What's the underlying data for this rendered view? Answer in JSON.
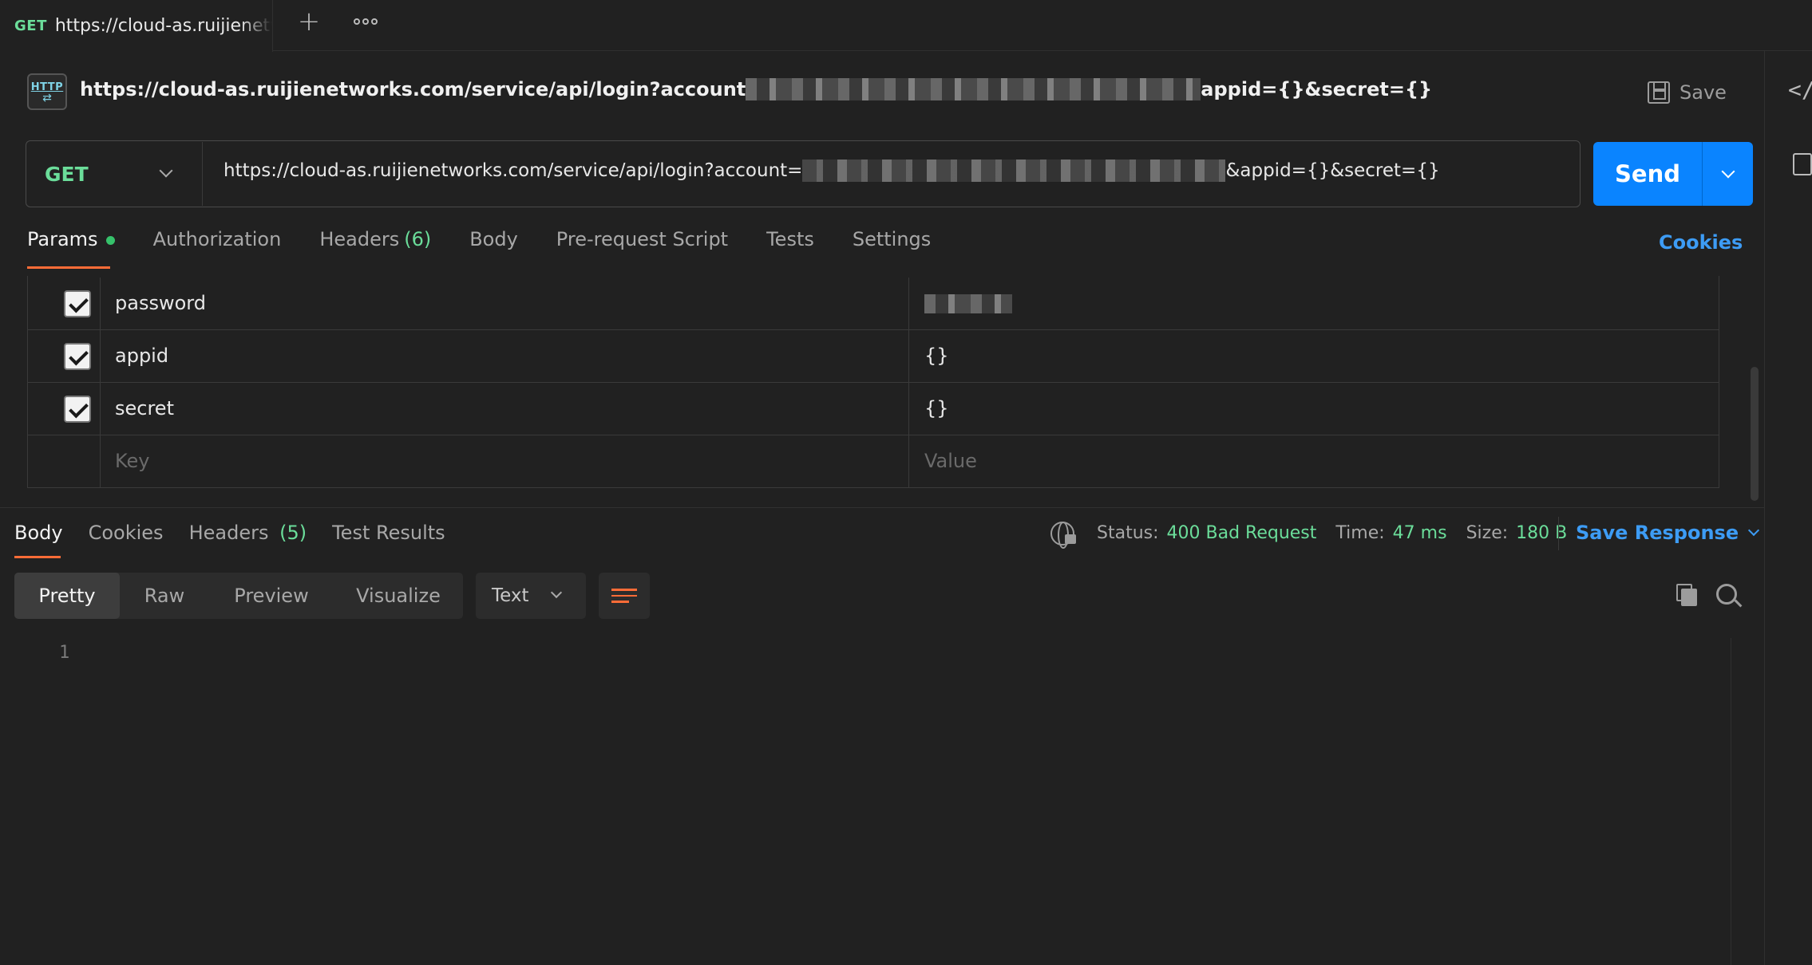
{
  "tab": {
    "method": "GET",
    "title": "https://cloud-as.ruijienetw"
  },
  "request": {
    "title_prefix": "https://cloud-as.ruijienetworks.com/service/api/login?account",
    "title_suffix": "appid={}&secret={}",
    "save_label": "Save",
    "method": "GET",
    "url_prefix": "https://cloud-as.ruijienetworks.com/service/api/login?account=",
    "url_suffix": "&appid={}&secret={}",
    "send_label": "Send"
  },
  "request_tabs": [
    {
      "label": "Params",
      "count": ""
    },
    {
      "label": "Authorization",
      "count": ""
    },
    {
      "label": "Headers",
      "count": "(6)"
    },
    {
      "label": "Body",
      "count": ""
    },
    {
      "label": "Pre-request Script",
      "count": ""
    },
    {
      "label": "Tests",
      "count": ""
    },
    {
      "label": "Settings",
      "count": ""
    }
  ],
  "cookies_link": "Cookies",
  "params": [
    {
      "key": "password",
      "value": ""
    },
    {
      "key": "appid",
      "value": "{}"
    },
    {
      "key": "secret",
      "value": "{}"
    }
  ],
  "params_placeholder": {
    "key": "Key",
    "value": "Value"
  },
  "response": {
    "tabs": [
      {
        "label": "Body",
        "count": ""
      },
      {
        "label": "Cookies",
        "count": ""
      },
      {
        "label": "Headers",
        "count": "(5)"
      },
      {
        "label": "Test Results",
        "count": ""
      }
    ],
    "status_label": "Status:",
    "status_value": "400 Bad Request",
    "time_label": "Time:",
    "time_value": "47 ms",
    "size_label": "Size:",
    "size_value": "180 B",
    "save_response_label": "Save Response",
    "views": [
      "Pretty",
      "Raw",
      "Preview",
      "Visualize"
    ],
    "format": "Text",
    "line_number": "1"
  },
  "colors": {
    "accent": "#ff6c37",
    "send": "#0a84ff",
    "link": "#3d9cf5",
    "success": "#6bdd9a",
    "background": "#212121"
  }
}
